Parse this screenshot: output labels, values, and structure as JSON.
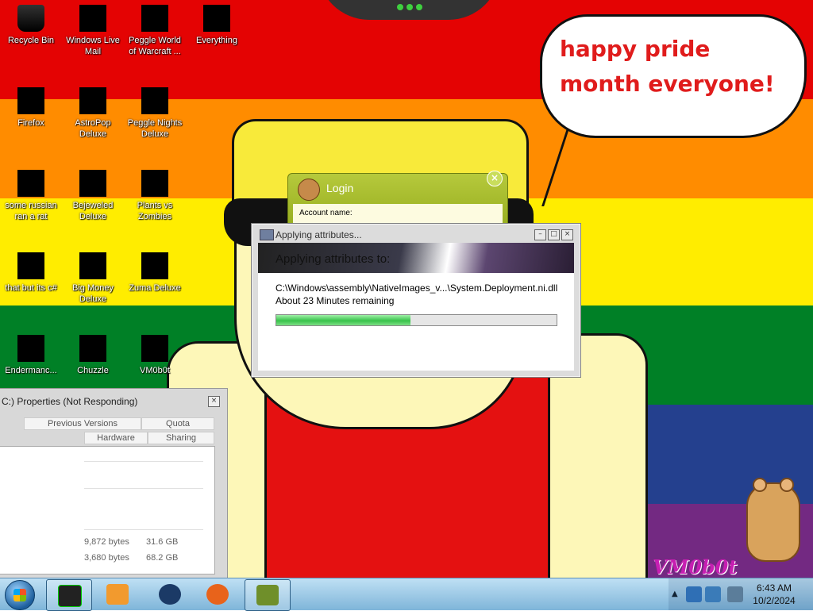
{
  "wallpaper": {
    "stripes": [
      "#e40303",
      "#ff8c00",
      "#ffed00",
      "#008026",
      "#24408e",
      "#732982"
    ],
    "speech_bubble": "happy pride month everyone!",
    "corner_logo": "VM0b0t"
  },
  "desktop_icons": [
    {
      "label": "Recycle Bin",
      "icon": "recycle-bin-icon"
    },
    {
      "label": "Windows Live Mail",
      "icon": "mail-icon"
    },
    {
      "label": "Peggle World of Warcraft ...",
      "icon": "peggle-icon"
    },
    {
      "label": "Everything",
      "icon": "search-icon"
    },
    {
      "label": "Firefox",
      "icon": "firefox-icon"
    },
    {
      "label": "AstroPop Deluxe",
      "icon": "astropop-icon"
    },
    {
      "label": "Peggle Nights Deluxe",
      "icon": "peggle-nights-icon"
    },
    {
      "label": "some russian ran a rat",
      "icon": "app-icon"
    },
    {
      "label": "Bejeweled Deluxe",
      "icon": "gem-icon"
    },
    {
      "label": "Plants vs Zombies",
      "icon": "plant-icon"
    },
    {
      "label": "that but its c#",
      "icon": "app-icon"
    },
    {
      "label": "Big Money Deluxe",
      "icon": "money-bag-icon"
    },
    {
      "label": "Zuma Deluxe",
      "icon": "zuma-icon"
    },
    {
      "label": "Endermanc...",
      "icon": "app-icon"
    },
    {
      "label": "Chuzzle",
      "icon": "chuzzle-icon"
    },
    {
      "label": "VM0b0t",
      "icon": "app-icon"
    }
  ],
  "login_window": {
    "title": "Login",
    "account_label": "Account name:"
  },
  "attr_dialog": {
    "title": "Applying attributes...",
    "heading": "Applying attributes to:",
    "file_path": "C:\\Windows\\assembly\\NativeImages_v...\\System.Deployment.ni.dll",
    "time_remaining": "About 23 Minutes remaining",
    "progress": 0.48
  },
  "properties_window": {
    "title": "C:) Properties (Not Responding)",
    "tabs_row1": [
      "Previous Versions",
      "Quota"
    ],
    "tabs_row2": [
      "Hardware",
      "Sharing"
    ],
    "rows": [
      {
        "bytes": "9,872 bytes",
        "size": "31.6 GB"
      },
      {
        "bytes": "3,680 bytes",
        "size": "68.2 GB"
      }
    ]
  },
  "taskbar": {
    "pinned": [
      {
        "name": "terminal",
        "color": "#222222"
      },
      {
        "name": "media-player",
        "color": "#f29a2e"
      },
      {
        "name": "globe",
        "color": "#1b3a66"
      },
      {
        "name": "firefox",
        "color": "#e8631b"
      },
      {
        "name": "box-game",
        "color": "#6f8f2a"
      }
    ],
    "clock_time": "6:43 AM",
    "clock_date": "10/2/2024"
  }
}
